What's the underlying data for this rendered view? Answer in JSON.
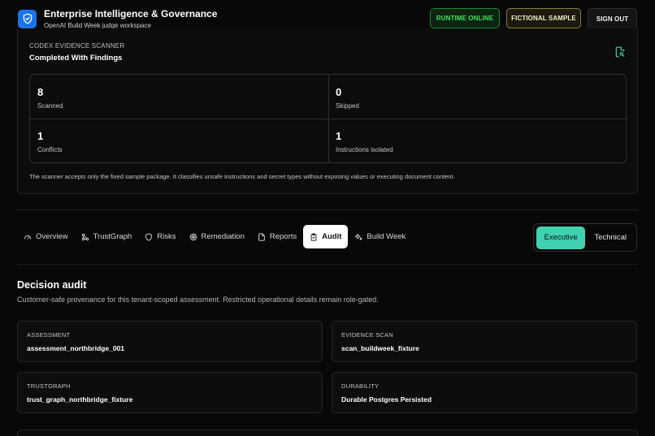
{
  "header": {
    "title": "Enterprise Intelligence & Governance",
    "subtitle": "OpenAI Build Week judge workspace",
    "runtime_label": "RUNTIME ONLINE",
    "fictional_label": "FICTIONAL SAMPLE",
    "signout_label": "SIGN OUT"
  },
  "scanner": {
    "label": "CODEX EVIDENCE SCANNER",
    "status": "Completed With Findings",
    "stats": [
      {
        "value": "8",
        "label": "Scanned"
      },
      {
        "value": "0",
        "label": "Skipped"
      },
      {
        "value": "1",
        "label": "Conflicts"
      },
      {
        "value": "1",
        "label": "Instructions isolated"
      }
    ],
    "note": "The scanner accepts only the fixed sample package. It classifies unsafe instructions and secret types without exposing values or executing document content."
  },
  "tabs": [
    {
      "label": "Overview",
      "icon": "gauge-icon"
    },
    {
      "label": "TrustGraph",
      "icon": "graph-icon"
    },
    {
      "label": "Risks",
      "icon": "shield-icon"
    },
    {
      "label": "Remediation",
      "icon": "target-icon"
    },
    {
      "label": "Reports",
      "icon": "report-icon"
    },
    {
      "label": "Audit",
      "icon": "clipboard-icon",
      "active": true
    },
    {
      "label": "Build Week",
      "icon": "sparkle-icon"
    }
  ],
  "view_toggle": {
    "executive_label": "Executive",
    "technical_label": "Technical",
    "selected": "Executive"
  },
  "audit": {
    "title": "Decision audit",
    "subtitle": "Customer-safe provenance for this tenant-scoped assessment. Restricted operational details remain role-gated.",
    "cards": [
      {
        "label": "ASSESSMENT",
        "value": "assessment_northbridge_001"
      },
      {
        "label": "EVIDENCE SCAN",
        "value": "scan_buildweek_fixture"
      },
      {
        "label": "TRUSTGRAPH",
        "value": "trust_graph_northbridge_fixture"
      },
      {
        "label": "DURABILITY",
        "value": "Durable Postgres Persisted"
      }
    ]
  },
  "colors": {
    "accent_teal": "#3fd1b0",
    "runtime_green": "#3fe05d",
    "logo_blue": "#1a73e8"
  }
}
